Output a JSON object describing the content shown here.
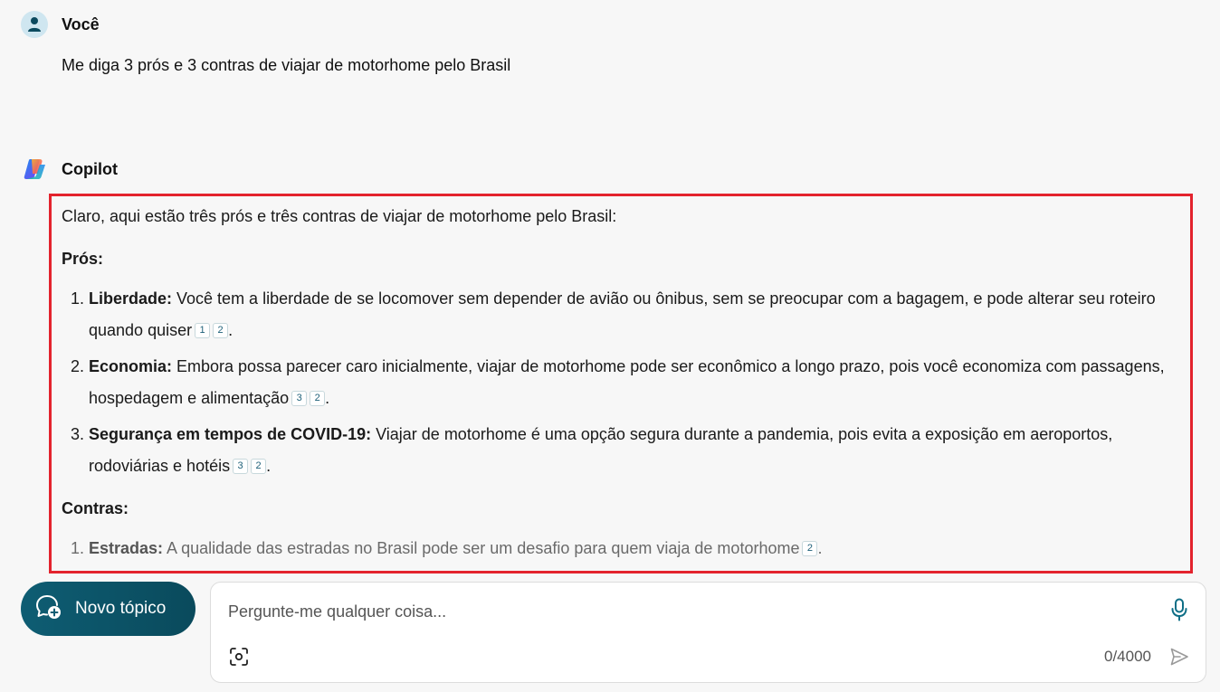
{
  "user": {
    "name": "Você",
    "message": "Me diga 3 prós e 3 contras de viajar de motorhome pelo Brasil"
  },
  "copilot": {
    "name": "Copilot",
    "intro": "Claro, aqui estão três prós e três contras de viajar de motorhome pelo Brasil:",
    "pros_title": "Prós:",
    "pros": [
      {
        "title": "Liberdade:",
        "text": " Você tem a liberdade de se locomover sem depender de avião ou ônibus, sem se preocupar com a bagagem, e pode alterar seu roteiro quando quiser",
        "citations": [
          "1",
          "2"
        ]
      },
      {
        "title": "Economia:",
        "text": " Embora possa parecer caro inicialmente, viajar de motorhome pode ser econômico a longo prazo, pois você economiza com passagens, hospedagem e alimentação",
        "citations": [
          "3",
          "2"
        ]
      },
      {
        "title": "Segurança em tempos de COVID-19:",
        "text": " Viajar de motorhome é uma opção segura durante a pandemia, pois evita a exposição em aeroportos, rodoviárias e hotéis",
        "citations": [
          "3",
          "2"
        ]
      }
    ],
    "cons_title": "Contras:",
    "cons": [
      {
        "title": "Estradas:",
        "text": " A qualidade das estradas no Brasil pode ser um desafio para quem viaja de motorhome",
        "citations": [
          "2"
        ]
      }
    ],
    "period": "."
  },
  "bottom": {
    "new_topic_label": "Novo tópico",
    "input_placeholder": "Pergunte-me qualquer coisa...",
    "char_count": "0/4000"
  },
  "colors": {
    "accent": "#0e5d73",
    "highlight_border": "#e3232d",
    "background": "#f7f7f7"
  },
  "icons": {
    "user_avatar": "person-icon",
    "copilot_logo": "copilot-logo-icon",
    "new_topic": "chat-add-icon",
    "mic": "microphone-icon",
    "scan": "visual-search-icon",
    "send": "send-icon"
  }
}
